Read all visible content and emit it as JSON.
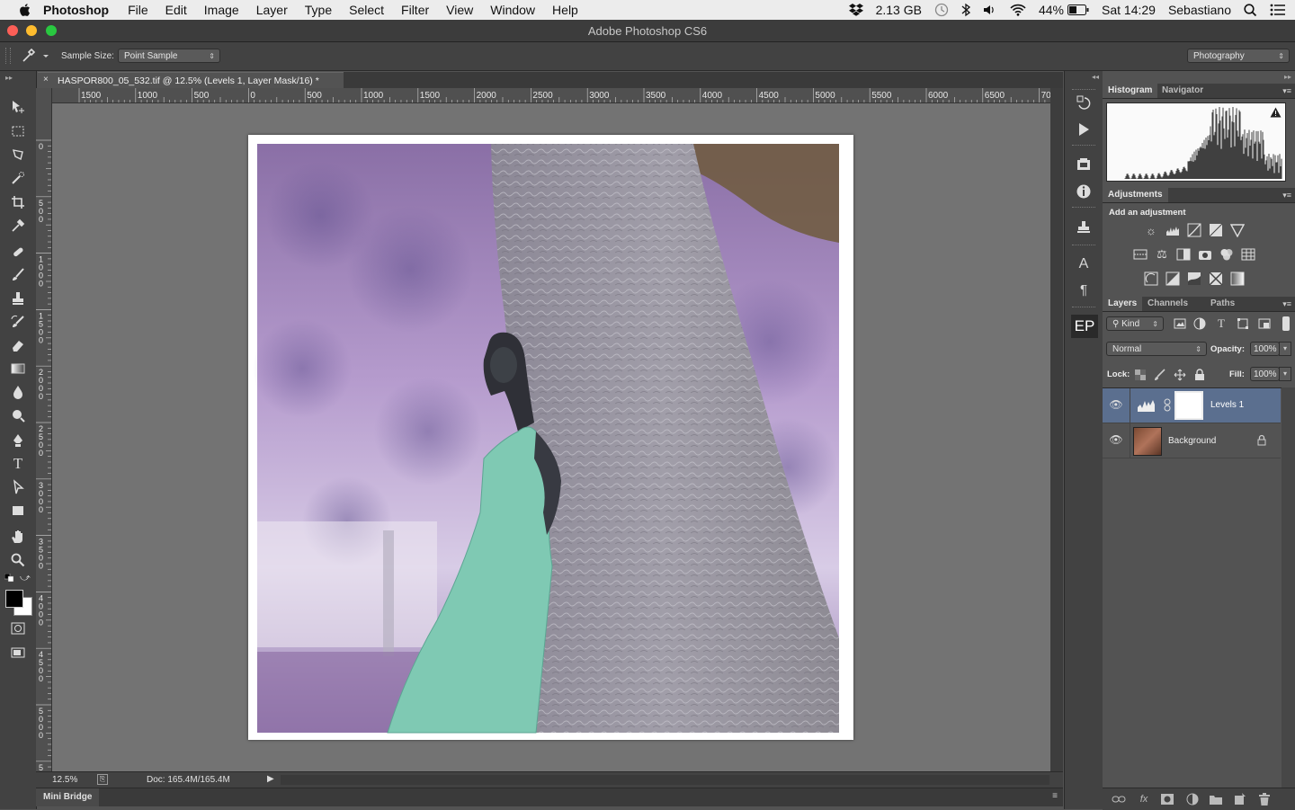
{
  "menubar": {
    "app": "Photoshop",
    "items": [
      "File",
      "Edit",
      "Image",
      "Layer",
      "Type",
      "Select",
      "Filter",
      "View",
      "Window",
      "Help"
    ],
    "storage": "2.13 GB",
    "battery": "44%",
    "clock": "Sat 14:29",
    "user": "Sebastiano"
  },
  "window": {
    "title": "Adobe Photoshop CS6"
  },
  "options": {
    "sample_size_label": "Sample Size:",
    "sample_size_value": "Point Sample",
    "workspace": "Photography"
  },
  "document": {
    "tab_title": "HASPOR800_05_532.tif @ 12.5% (Levels 1, Layer Mask/16) *",
    "zoom": "12.5%",
    "doc_size": "Doc: 165.4M/165.4M"
  },
  "ruler": {
    "h_labels": [
      "1500",
      "1000",
      "500",
      "0",
      "500",
      "1000",
      "1500",
      "2000",
      "2500",
      "3000",
      "3500",
      "4000",
      "4500",
      "5000",
      "5500",
      "6000",
      "6500",
      "70"
    ],
    "v_labels": [
      "0",
      "5 0 0",
      "1 0 0 0",
      "1 5 0 0",
      "2 0 0 0",
      "2 5 0 0",
      "3 0 0 0",
      "3 5 0 0",
      "4 0 0 0",
      "4 5 0 0",
      "5 0 0 0",
      "5"
    ]
  },
  "bottom": {
    "mini_bridge": "Mini Bridge"
  },
  "panels": {
    "histogram_tab": "Histogram",
    "navigator_tab": "Navigator",
    "adjustments_tab": "Adjustments",
    "add_adjustment": "Add an adjustment",
    "layers_tab": "Layers",
    "channels_tab": "Channels",
    "paths_tab": "Paths",
    "kind_filter": "Kind",
    "blend_mode": "Normal",
    "opacity_label": "Opacity:",
    "opacity_value": "100%",
    "lock_label": "Lock:",
    "fill_label": "Fill:",
    "fill_value": "100%"
  },
  "layers": [
    {
      "name": "Levels 1",
      "selected": true
    },
    {
      "name": "Background",
      "selected": false,
      "locked": true
    }
  ],
  "dock": {
    "ep_label": "EP"
  },
  "colors": {
    "accent_selected": "#5b6f8f",
    "foreground": "#000000",
    "background": "#ffffff"
  }
}
